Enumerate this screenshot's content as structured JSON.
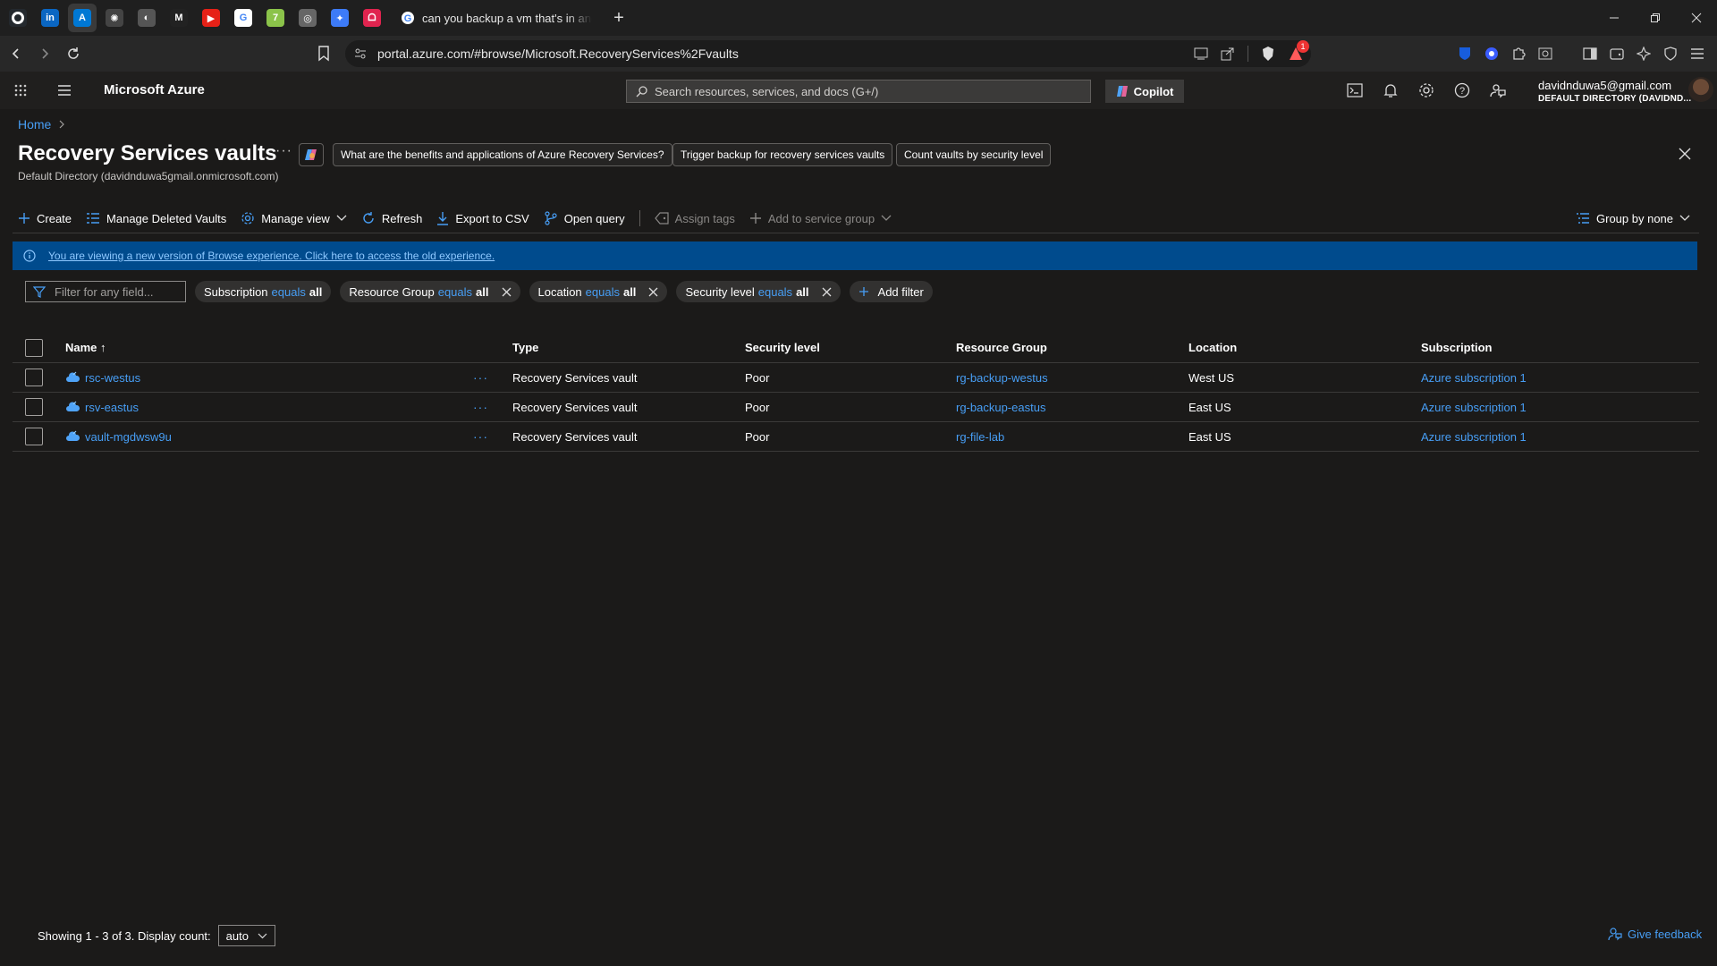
{
  "browser": {
    "pinned_tabs": [
      {
        "name": "github",
        "glyph": "",
        "color": "#24292e"
      },
      {
        "name": "linkedin",
        "glyph": "in",
        "color": "#0a66c2"
      },
      {
        "name": "azure",
        "glyph": "A",
        "color": "#0078d4"
      },
      {
        "name": "openai",
        "glyph": "✺",
        "color": "#444"
      },
      {
        "name": "generic",
        "glyph": "◐",
        "color": "#555"
      },
      {
        "name": "medium",
        "glyph": "M",
        "color": "#222"
      },
      {
        "name": "youtube",
        "glyph": "▶",
        "color": "#e62117"
      },
      {
        "name": "google",
        "glyph": "G",
        "color": "#fff"
      },
      {
        "name": "seven",
        "glyph": "7",
        "color": "#8bc34a"
      },
      {
        "name": "globe",
        "glyph": "◎",
        "color": "#666"
      },
      {
        "name": "gemini",
        "glyph": "✦",
        "color": "#3d7bf7"
      },
      {
        "name": "app",
        "glyph": "ᗝ",
        "color": "#e0244f"
      }
    ],
    "active_tab_title": "can you backup a vm that's in anothe",
    "url": "portal.azure.com/#browse/Microsoft.RecoveryServices%2Fvaults",
    "shield_badge": "1"
  },
  "header": {
    "brand": "Microsoft Azure",
    "search_placeholder": "Search resources, services, and docs (G+/)",
    "copilot_label": "Copilot",
    "account_email": "davidnduwa5@gmail.com",
    "account_directory": "DEFAULT DIRECTORY (DAVIDND..."
  },
  "page": {
    "breadcrumb_home": "Home",
    "title": "Recovery Services vaults",
    "subtitle": "Default Directory (davidnduwa5gmail.onmicrosoft.com)",
    "suggestions": [
      "What are the benefits and applications of Azure Recovery Services?",
      "Trigger backup for recovery services vaults",
      "Count vaults by security level"
    ]
  },
  "toolbar": {
    "create": "Create",
    "manage_deleted": "Manage Deleted Vaults",
    "manage_view": "Manage view",
    "refresh": "Refresh",
    "export": "Export to CSV",
    "open_query": "Open query",
    "assign_tags": "Assign tags",
    "add_service_group": "Add to service group",
    "group_by": "Group by none"
  },
  "info_banner": "You are viewing a new version of Browse experience. Click here to access the old experience.",
  "filters": {
    "placeholder": "Filter for any field...",
    "pills": [
      {
        "field": "Subscription",
        "op": "equals",
        "value": "all",
        "removable": false
      },
      {
        "field": "Resource Group",
        "op": "equals",
        "value": "all",
        "removable": true
      },
      {
        "field": "Location",
        "op": "equals",
        "value": "all",
        "removable": true
      },
      {
        "field": "Security level",
        "op": "equals",
        "value": "all",
        "removable": true
      }
    ],
    "add_filter": "Add filter"
  },
  "table": {
    "columns": {
      "name": "Name ↑",
      "type": "Type",
      "security": "Security level",
      "rg": "Resource Group",
      "location": "Location",
      "subscription": "Subscription"
    },
    "rows": [
      {
        "name": "rsc-westus",
        "type": "Recovery Services vault",
        "security": "Poor",
        "rg": "rg-backup-westus",
        "location": "West US",
        "subscription": "Azure subscription 1"
      },
      {
        "name": "rsv-eastus",
        "type": "Recovery Services vault",
        "security": "Poor",
        "rg": "rg-backup-eastus",
        "location": "East US",
        "subscription": "Azure subscription 1"
      },
      {
        "name": "vault-mgdwsw9u",
        "type": "Recovery Services vault",
        "security": "Poor",
        "rg": "rg-file-lab",
        "location": "East US",
        "subscription": "Azure subscription 1"
      }
    ]
  },
  "footer": {
    "showing": "Showing 1 - 3 of 3. Display count:",
    "display_count": "auto",
    "feedback": "Give feedback"
  },
  "colors": {
    "accent_link": "#479ef5",
    "banner": "#004b8d",
    "background": "#1b1a19"
  }
}
